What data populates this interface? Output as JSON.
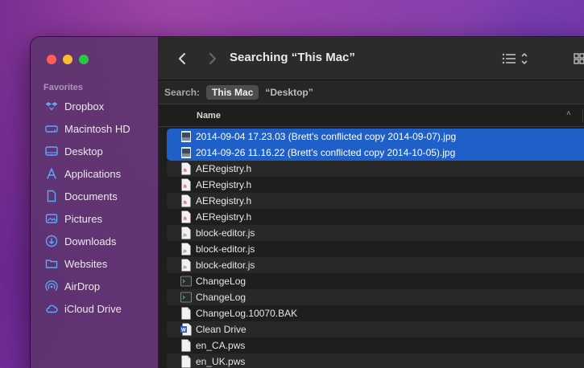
{
  "sidebar": {
    "header": "Favorites",
    "items": [
      {
        "label": "Dropbox",
        "icon": "dropbox-icon"
      },
      {
        "label": "Macintosh HD",
        "icon": "hard-drive-icon"
      },
      {
        "label": "Desktop",
        "icon": "desktop-icon"
      },
      {
        "label": "Applications",
        "icon": "applications-icon"
      },
      {
        "label": "Documents",
        "icon": "document-icon"
      },
      {
        "label": "Pictures",
        "icon": "pictures-icon"
      },
      {
        "label": "Downloads",
        "icon": "downloads-icon"
      },
      {
        "label": "Websites",
        "icon": "folder-icon"
      },
      {
        "label": "AirDrop",
        "icon": "airdrop-icon"
      },
      {
        "label": "iCloud Drive",
        "icon": "cloud-icon"
      }
    ]
  },
  "toolbar": {
    "title": "Searching “This Mac”"
  },
  "scopebar": {
    "label": "Search:",
    "active": "This Mac",
    "other": "“Desktop”"
  },
  "columns": {
    "name": "Name"
  },
  "files": [
    {
      "name": "2014-09-04 17.23.03 (Brett's conflicted copy 2014-09-07).jpg",
      "icon": "image-file-icon",
      "selected": true
    },
    {
      "name": "2014-09-26 11.16.22 (Brett's conflicted copy 2014-10-05).jpg",
      "icon": "image-file-icon",
      "selected": true
    },
    {
      "name": "AERegistry.h",
      "icon": "header-file-icon",
      "selected": false
    },
    {
      "name": "AERegistry.h",
      "icon": "header-file-icon",
      "selected": false
    },
    {
      "name": "AERegistry.h",
      "icon": "header-file-icon",
      "selected": false
    },
    {
      "name": "AERegistry.h",
      "icon": "header-file-icon",
      "selected": false
    },
    {
      "name": "block-editor.js",
      "icon": "js-file-icon",
      "selected": false
    },
    {
      "name": "block-editor.js",
      "icon": "js-file-icon",
      "selected": false
    },
    {
      "name": "block-editor.js",
      "icon": "js-file-icon",
      "selected": false
    },
    {
      "name": "ChangeLog",
      "icon": "terminal-file-icon",
      "selected": false
    },
    {
      "name": "ChangeLog",
      "icon": "terminal-file-icon",
      "selected": false
    },
    {
      "name": "ChangeLog.10070.BAK",
      "icon": "blank-file-icon",
      "selected": false
    },
    {
      "name": "Clean Drive",
      "icon": "word-document-icon",
      "selected": false
    },
    {
      "name": "en_CA.pws",
      "icon": "blank-file-icon",
      "selected": false
    },
    {
      "name": "en_UK.pws",
      "icon": "blank-file-icon",
      "selected": false
    }
  ],
  "colors": {
    "selection": "#1f5fc8",
    "sidebar_icon": "#5aa8ff"
  }
}
